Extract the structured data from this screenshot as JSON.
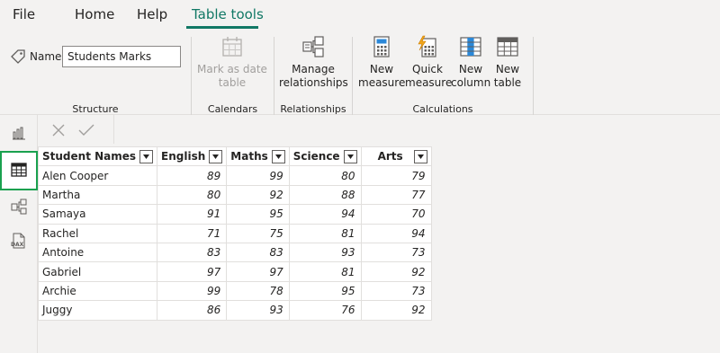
{
  "menu": {
    "file": "File",
    "home": "Home",
    "help": "Help",
    "table_tools": "Table tools"
  },
  "ribbon": {
    "name_label": "Name",
    "name_value": "Students Marks",
    "mark_as_date_line1": "Mark as date",
    "mark_as_date_line2": "table",
    "manage_line1": "Manage",
    "manage_line2": "relationships",
    "new_measure_line1": "New",
    "new_measure_line2": "measure",
    "quick_measure_line1": "Quick",
    "quick_measure_line2": "measure",
    "new_column_line1": "New",
    "new_column_line2": "column",
    "new_table_line1": "New",
    "new_table_line2": "table",
    "groups": {
      "structure": "Structure",
      "calendars": "Calendars",
      "relationships": "Relationships",
      "calculations": "Calculations"
    }
  },
  "table": {
    "headers": [
      "Student Names",
      "English",
      "Maths",
      "Science",
      "Arts"
    ],
    "rows": [
      [
        "Alen Cooper",
        "89",
        "99",
        "80",
        "79"
      ],
      [
        "Martha",
        "80",
        "92",
        "88",
        "77"
      ],
      [
        "Samaya",
        "91",
        "95",
        "94",
        "70"
      ],
      [
        "Rachel",
        "71",
        "75",
        "81",
        "94"
      ],
      [
        "Antoine",
        "83",
        "83",
        "93",
        "73"
      ],
      [
        "Gabriel",
        "97",
        "97",
        "81",
        "92"
      ],
      [
        "Archie",
        "99",
        "78",
        "95",
        "73"
      ],
      [
        "Juggy",
        "86",
        "93",
        "76",
        "92"
      ]
    ]
  },
  "colors": {
    "accent": "#117865",
    "active_view_border": "#1aa14f"
  }
}
